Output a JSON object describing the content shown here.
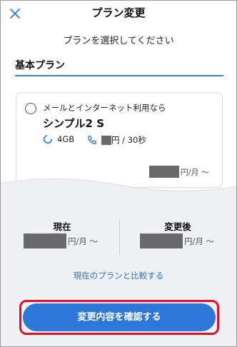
{
  "header": {
    "title": "プラン変更",
    "close_icon": "close-icon"
  },
  "subtitle": "プランを選択してください",
  "section": {
    "title": "基本プラン"
  },
  "plan_card": {
    "description": "メールとインターネット利用なら",
    "name": "シンプル2 S",
    "data_amount": "4GB",
    "call_unit": "円 / 30秒",
    "price_suffix": "円/月 ～"
  },
  "comparison": {
    "current_label": "現在",
    "current_suffix": "円/月 ～",
    "after_label": "変更後",
    "after_suffix": "円/月 ～"
  },
  "compare_link": "現在のプランと比較する",
  "confirm_button": "変更内容を確認する",
  "colors": {
    "accent": "#2d77d9",
    "link": "#2e6fc7",
    "highlight_outline": "#e0102a",
    "redaction": "#6a6a6a"
  }
}
